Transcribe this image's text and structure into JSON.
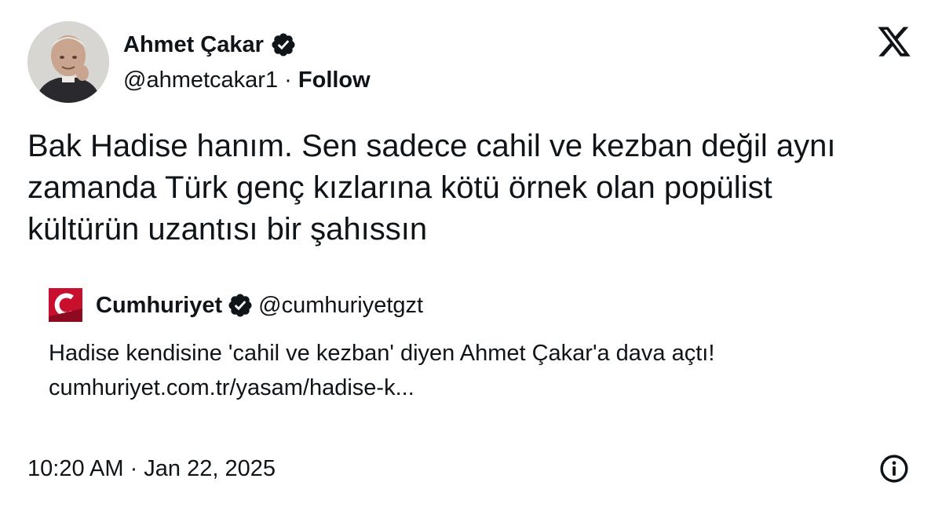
{
  "author": {
    "name": "Ahmet Çakar",
    "handle": "@ahmetcakar1",
    "separator": "·",
    "follow_label": "Follow",
    "verified": true
  },
  "brand_icon": "x-logo-icon",
  "tweet": {
    "lines": [
      "Bak Hadise hanım. Sen sadece cahil ve kezban değil aynı",
      "zamanda Türk genç kızlarına kötü örnek olan popülist",
      "kültürün uzantısı bir şahıssın"
    ]
  },
  "quoted": {
    "logo_letter": "C",
    "name": "Cumhuriyet",
    "handle": "@cumhuriyetgzt",
    "verified": true,
    "text": "Hadise kendisine 'cahil ve kezban' diyen Ahmet Çakar'a dava açtı!",
    "link": "cumhuriyet.com.tr/yasam/hadise-k..."
  },
  "footer": {
    "timestamp": "10:20 AM · Jan 22, 2025",
    "info_icon": "info-icon"
  },
  "colors": {
    "text": "#0f1419",
    "cumhuriyet_red": "#c8102e",
    "background": "#ffffff"
  }
}
